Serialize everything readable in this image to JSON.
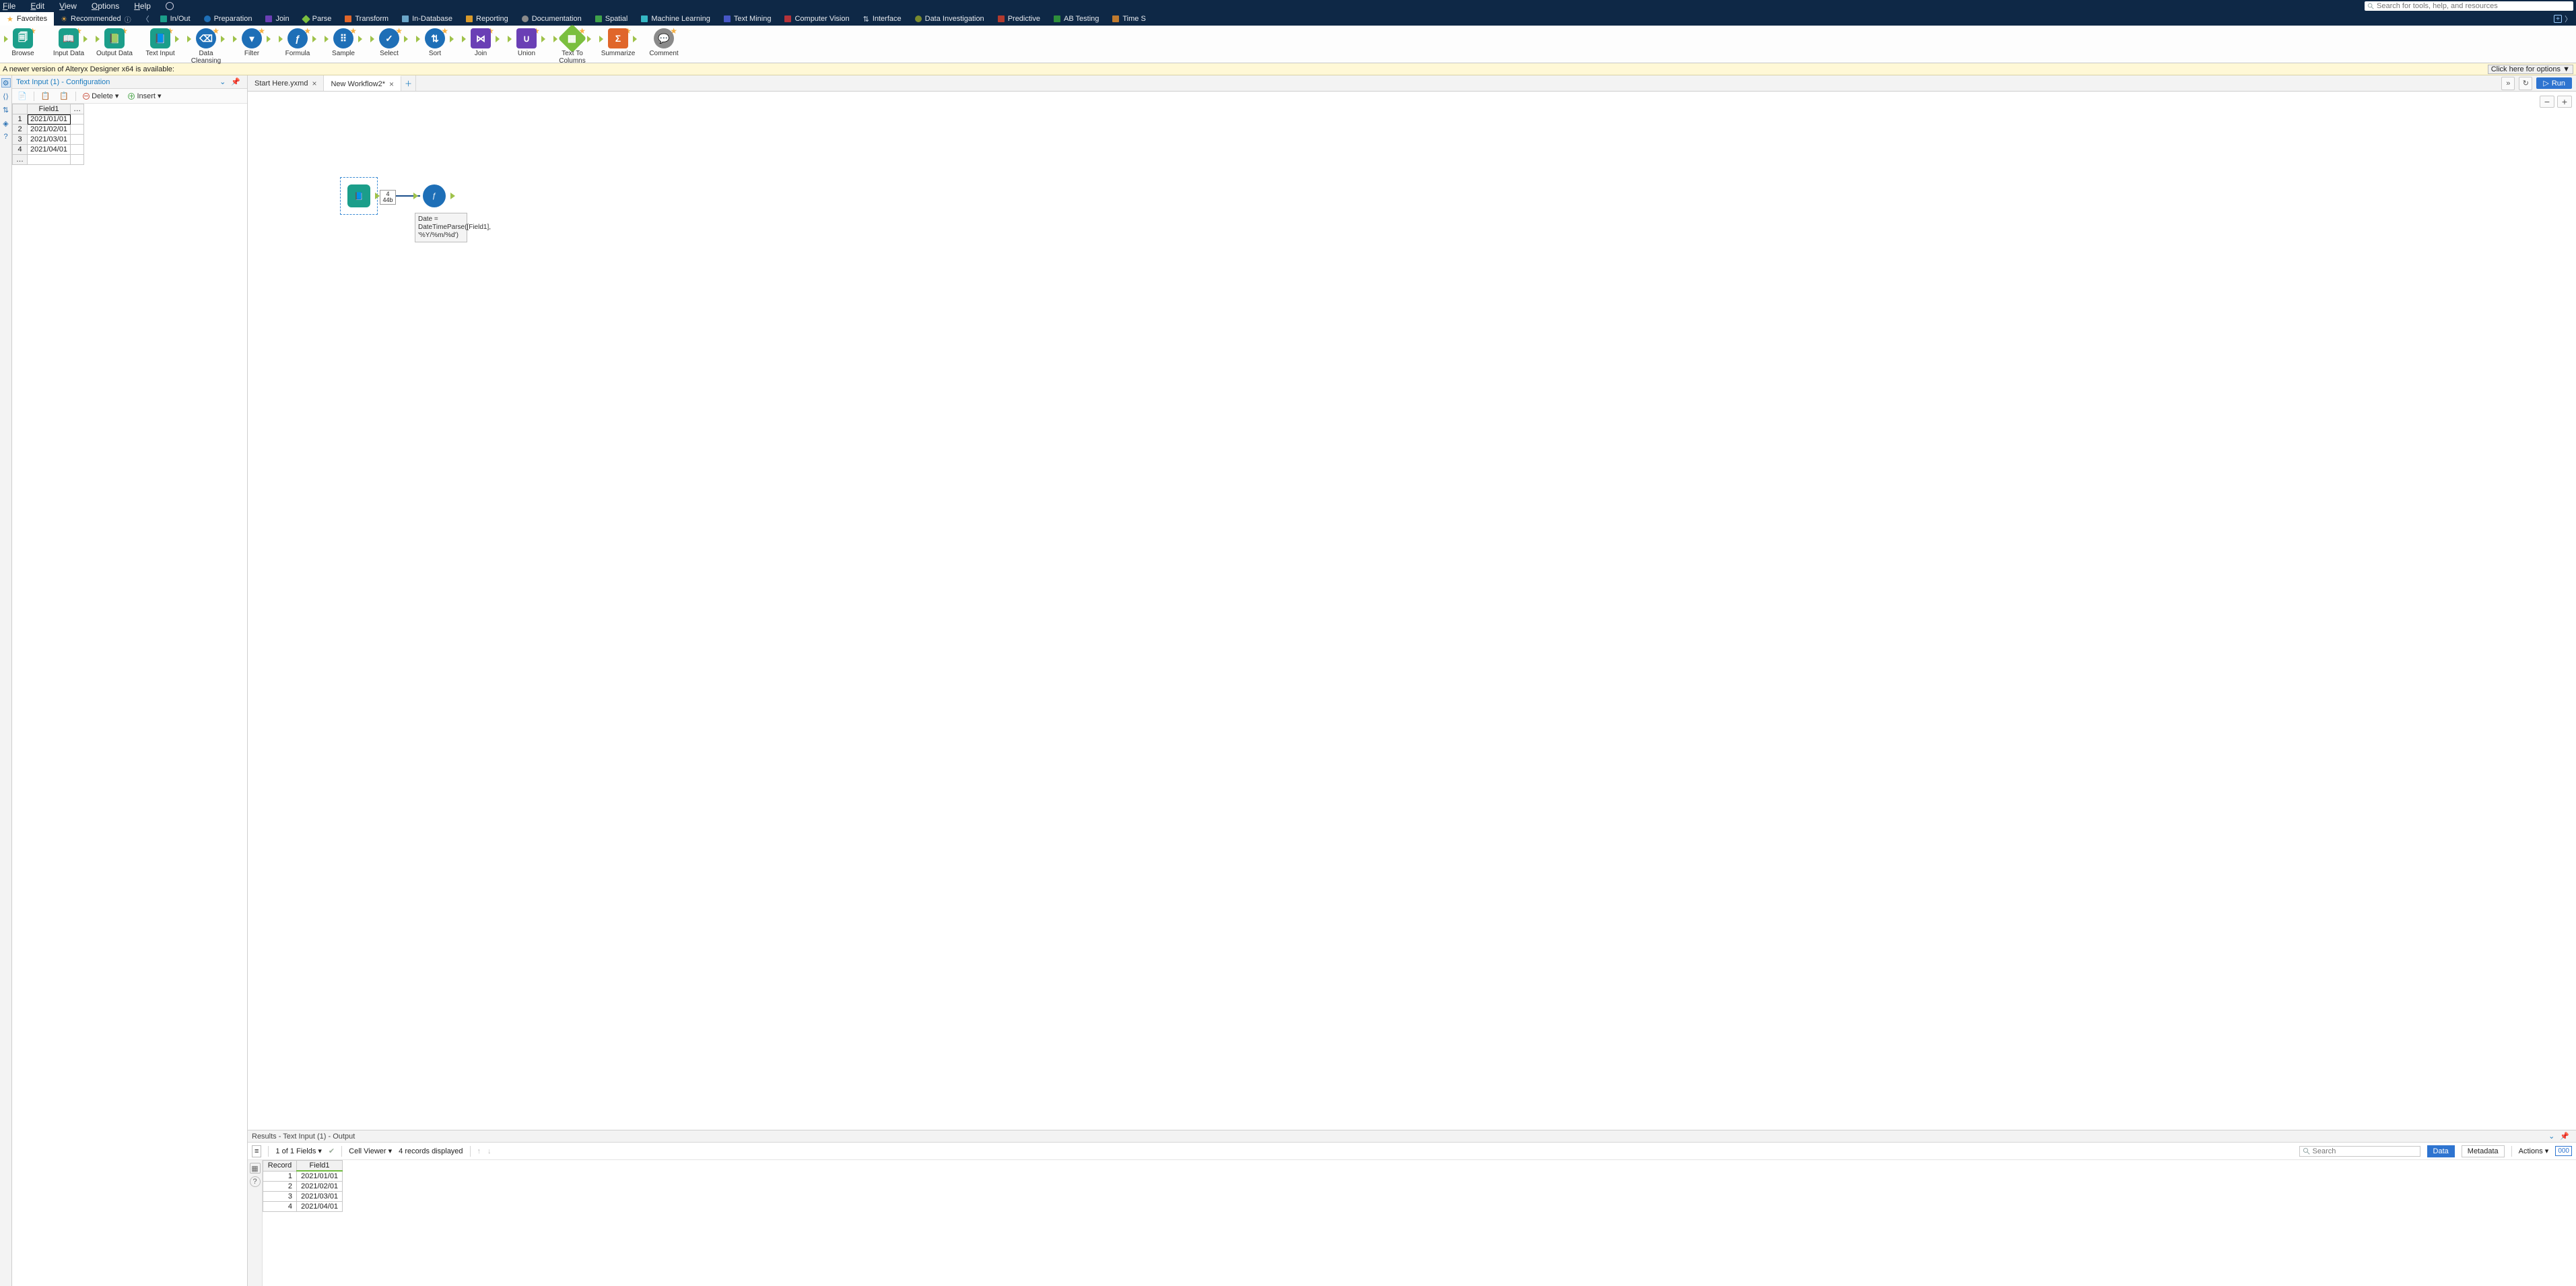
{
  "menu": {
    "file": "File",
    "edit": "Edit",
    "view": "View",
    "options": "Options",
    "help": "Help"
  },
  "search_placeholder": "Search for tools, help, and resources",
  "categories": {
    "favorites": "Favorites",
    "recommended": "Recommended",
    "inout": "In/Out",
    "preparation": "Preparation",
    "join": "Join",
    "parse": "Parse",
    "transform": "Transform",
    "indatabase": "In-Database",
    "reporting": "Reporting",
    "documentation": "Documentation",
    "spatial": "Spatial",
    "ml": "Machine Learning",
    "textmining": "Text Mining",
    "cv": "Computer Vision",
    "interface": "Interface",
    "di": "Data Investigation",
    "predictive": "Predictive",
    "ab": "AB Testing",
    "time": "Time S"
  },
  "tools": {
    "browse": "Browse",
    "inputdata": "Input Data",
    "outputdata": "Output Data",
    "textinput": "Text Input",
    "datacleansing": "Data Cleansing",
    "filter": "Filter",
    "formula": "Formula",
    "sample": "Sample",
    "select": "Select",
    "sort": "Sort",
    "join": "Join",
    "union": "Union",
    "texttocolumns": "Text To Columns",
    "summarize": "Summarize",
    "comment": "Comment"
  },
  "banner": {
    "msg": "A newer version of Alteryx Designer x64 is available:",
    "opts": "Click here for options ▼"
  },
  "config": {
    "title": "Text Input (1) - Configuration",
    "delete": "Delete",
    "insert": "Insert",
    "header": "Field1",
    "rows": [
      {
        "n": "1",
        "v": "2021/01/01"
      },
      {
        "n": "2",
        "v": "2021/02/01"
      },
      {
        "n": "3",
        "v": "2021/03/01"
      },
      {
        "n": "4",
        "v": "2021/04/01"
      }
    ]
  },
  "tabs": {
    "t1": "Start Here.yxmd",
    "t2": "New Workflow2*"
  },
  "run_label": "Run",
  "canvas": {
    "count_top": "4",
    "count_bottom": "44b",
    "annot": "Date = DateTimeParse([Field1], '%Y/%m/%d')"
  },
  "results": {
    "title": "Results - Text Input (1) - Output",
    "fieldcount": "1 of 1 Fields",
    "cellviewer": "Cell Viewer",
    "recsdisplayed": "4 records displayed",
    "search_placeholder": "Search",
    "data": "Data",
    "metadata": "Metadata",
    "actions": "Actions",
    "numbox": "000",
    "col_record": "Record",
    "col_field": "Field1",
    "rows": [
      {
        "n": "1",
        "v": "2021/01/01"
      },
      {
        "n": "2",
        "v": "2021/02/01"
      },
      {
        "n": "3",
        "v": "2021/03/01"
      },
      {
        "n": "4",
        "v": "2021/04/01"
      }
    ]
  }
}
